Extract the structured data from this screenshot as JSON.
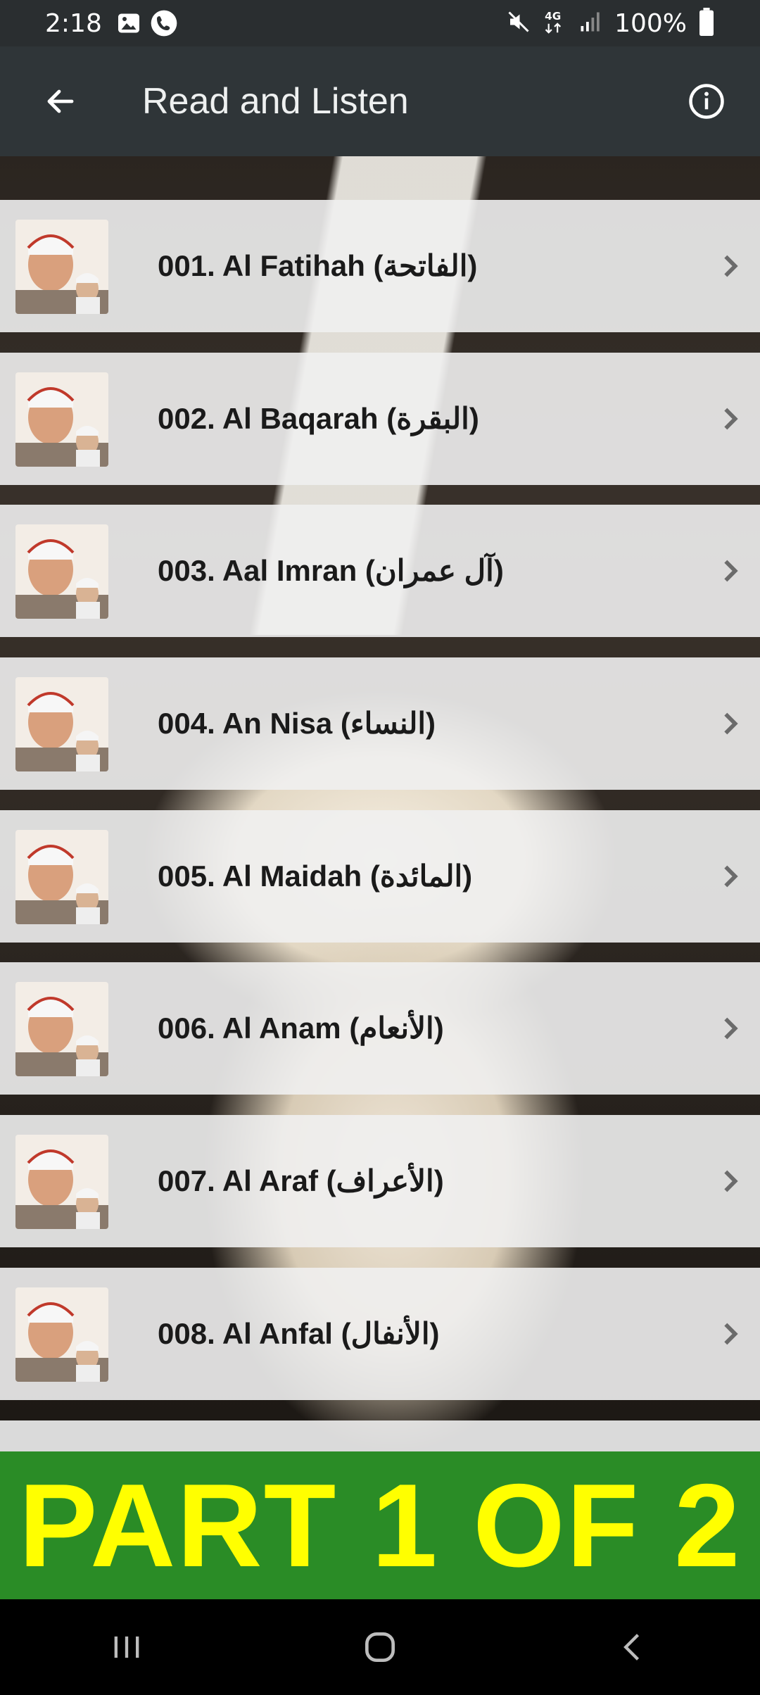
{
  "status_bar": {
    "time": "2:18",
    "battery": "100%",
    "network": "4G",
    "icons": [
      "gallery-icon",
      "call-icon",
      "mute-icon",
      "network-4g-icon",
      "signal-icon",
      "battery-icon"
    ]
  },
  "app_bar": {
    "title": "Read and Listen",
    "back_icon": "arrow-left-icon",
    "info_icon": "info-circle-icon"
  },
  "list": {
    "items": [
      {
        "label": "001. Al Fatihah (الفاتحة)"
      },
      {
        "label": "002. Al Baqarah (البقرة)"
      },
      {
        "label": "003. Aal Imran (آل عمران)"
      },
      {
        "label": "004. An Nisa (النساء)"
      },
      {
        "label": "005. Al Maidah (المائدة)"
      },
      {
        "label": "006. Al Anam (الأنعام)"
      },
      {
        "label": "007. Al Araf (الأعراف)"
      },
      {
        "label": "008. Al Anfal (الأنفال)"
      }
    ],
    "chevron_icon": "chevron-right-icon",
    "row_image": "reciter-thumbnail"
  },
  "banner": {
    "text": "PART 1 OF 2",
    "background": "#2a8c26",
    "text_color": "#ffff00"
  },
  "nav_bar": {
    "buttons": [
      "recents-icon",
      "home-icon",
      "back-icon"
    ]
  }
}
